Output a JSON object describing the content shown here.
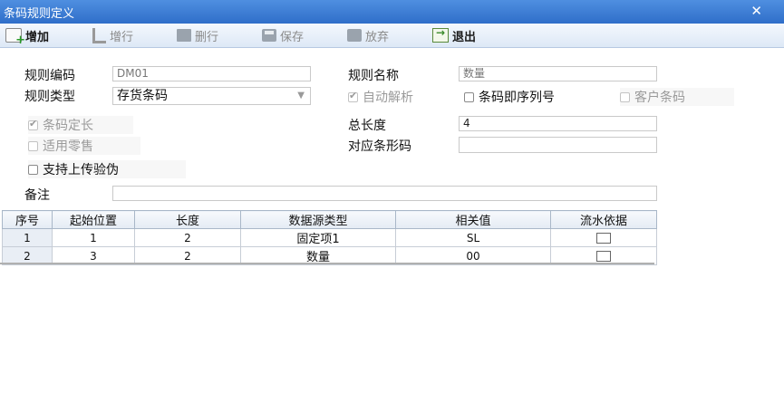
{
  "window": {
    "title": "条码规则定义",
    "close_glyph": "✕"
  },
  "toolbar": [
    {
      "label": "增加",
      "icon": "add-icon",
      "enabled": true
    },
    {
      "label": "增行",
      "icon": "add-row-icon",
      "enabled": false
    },
    {
      "label": "删行",
      "icon": "delete-row-icon",
      "enabled": false
    },
    {
      "label": "保存",
      "icon": "save-icon",
      "enabled": false
    },
    {
      "label": "放弃",
      "icon": "discard-icon",
      "enabled": false
    },
    {
      "label": "退出",
      "icon": "exit-icon",
      "enabled": true
    }
  ],
  "form": {
    "rule_code": {
      "label": "规则编码",
      "value": "DM01"
    },
    "rule_name": {
      "label": "规则名称",
      "value": "数量"
    },
    "rule_type": {
      "label": "规则类型",
      "value": "存货条码"
    },
    "auto_parse": {
      "label": "自动解析",
      "checked": true,
      "enabled": false
    },
    "barcode_serial": {
      "label": "条码即序列号",
      "checked": false,
      "enabled": true
    },
    "customer_barcode": {
      "label": "客户条码",
      "checked": false,
      "enabled": false
    },
    "fixed_length": {
      "label": "条码定长",
      "checked": true,
      "enabled": false
    },
    "total_length": {
      "label": "总长度",
      "value": "4"
    },
    "retail": {
      "label": "适用零售",
      "checked": false,
      "enabled": false
    },
    "barcode_mapping": {
      "label": "对应条形码",
      "value": ""
    },
    "anti_fake": {
      "label": "支持上传验伪",
      "checked": false,
      "enabled": true
    },
    "remark": {
      "label": "备注",
      "value": ""
    }
  },
  "grid": {
    "columns": [
      "序号",
      "起始位置",
      "长度",
      "数据源类型",
      "相关值",
      "流水依据"
    ],
    "rows": [
      {
        "seq": "1",
        "start": "1",
        "length": "2",
        "source_type": "固定项1",
        "value": "SL",
        "serial": false
      },
      {
        "seq": "2",
        "start": "3",
        "length": "2",
        "source_type": "数量",
        "value": "00",
        "serial": false
      }
    ]
  },
  "colors": {
    "titlebar": "#3a7bd5",
    "toolbar": "#e6eef9"
  }
}
